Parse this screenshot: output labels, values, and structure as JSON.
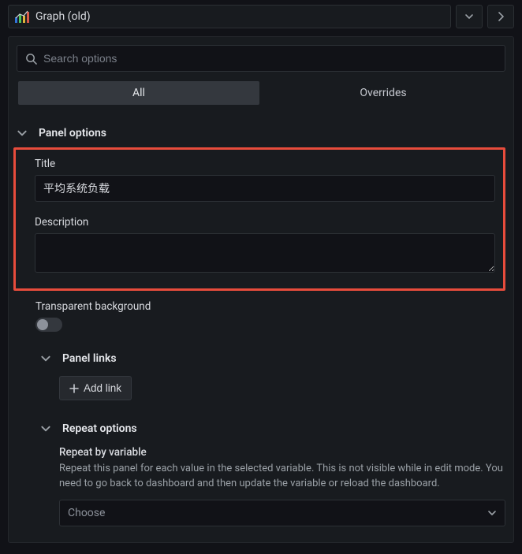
{
  "header": {
    "panel_type_label": "Graph (old)"
  },
  "search": {
    "placeholder": "Search options",
    "value": ""
  },
  "tabs": {
    "all": "All",
    "overrides": "Overrides",
    "active": "all"
  },
  "sections": {
    "panel_options": {
      "label": "Panel options",
      "title_label": "Title",
      "title_value": "平均系统负载",
      "description_label": "Description",
      "description_value": "",
      "transparent_label": "Transparent background",
      "transparent_on": false
    },
    "panel_links": {
      "label": "Panel links",
      "add_link_label": "Add link"
    },
    "repeat_options": {
      "label": "Repeat options",
      "field_label": "Repeat by variable",
      "help_text": "Repeat this panel for each value in the selected variable. This is not visible while in edit mode. You need to go back to dashboard and then update the variable or reload the dashboard.",
      "select_placeholder": "Choose"
    }
  }
}
